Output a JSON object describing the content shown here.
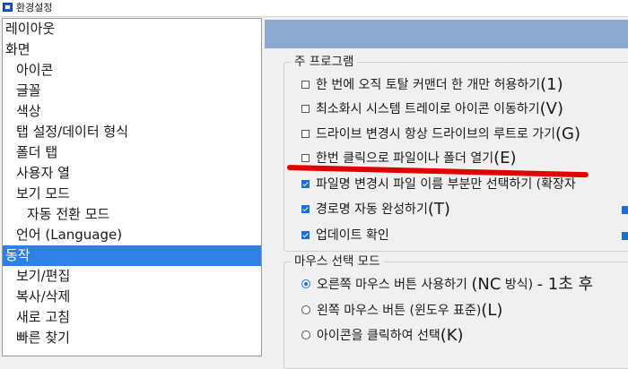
{
  "window": {
    "title": "환경설정"
  },
  "nav": {
    "items": [
      {
        "label": "레이아웃",
        "indent": 0,
        "selected": false
      },
      {
        "label": "화면",
        "indent": 0,
        "selected": false
      },
      {
        "label": "아이콘",
        "indent": 1,
        "selected": false
      },
      {
        "label": "글꼴",
        "indent": 1,
        "selected": false
      },
      {
        "label": "색상",
        "indent": 1,
        "selected": false
      },
      {
        "label": "탭 설정/데이터 형식",
        "indent": 1,
        "selected": false
      },
      {
        "label": "폴더 탭",
        "indent": 1,
        "selected": false
      },
      {
        "label": "사용자 열",
        "indent": 1,
        "selected": false
      },
      {
        "label": "보기 모드",
        "indent": 1,
        "selected": false
      },
      {
        "label": "자동 전환 모드",
        "indent": 2,
        "selected": false
      },
      {
        "label": "언어 (Language)",
        "indent": 1,
        "selected": false
      },
      {
        "label": "동작",
        "indent": 0,
        "selected": true
      },
      {
        "label": "보기/편집",
        "indent": 1,
        "selected": false
      },
      {
        "label": "복사/삭제",
        "indent": 1,
        "selected": false
      },
      {
        "label": "새로 고침",
        "indent": 1,
        "selected": false
      },
      {
        "label": "빠른 찾기",
        "indent": 1,
        "selected": false
      }
    ]
  },
  "main_program": {
    "title": "주 프로그램",
    "options": [
      {
        "text": "한 번에 오직 토탈 커맨더 한 개만 허용하기",
        "key": "(1)",
        "checked": false
      },
      {
        "text": "최소화시 시스템 트레이로 아이콘 이동하기",
        "key": "(V)",
        "checked": false
      },
      {
        "text": "드라이브 변경시 항상 드라이브의 루트로 가기",
        "key": "(G)",
        "checked": false
      },
      {
        "text": "한번 클릭으로 파일이나 폴더 열기",
        "key": "(E)",
        "checked": false
      },
      {
        "text": "파일명 변경시 파일 이름 부분만 선택하기 (확장자",
        "key": "",
        "checked": true
      },
      {
        "text": "경로명 자동 완성하기",
        "key": "(T)",
        "checked": true
      },
      {
        "text": "업데이트 확인",
        "key": "",
        "checked": true
      }
    ]
  },
  "mouse_mode": {
    "title": "마우스 선택 모드",
    "options": [
      {
        "pre": "오른쪽 마우스 버튼 사용하기 ",
        "em": "(NC",
        "mid": " 방식) ",
        "tail": "- 1초 후",
        "checked": true
      },
      {
        "pre": "왼쪽 마우스 버튼 (윈도우 표준)",
        "em": "(L)",
        "mid": "",
        "tail": "",
        "checked": false
      },
      {
        "pre": "아이콘을 클릭하여 선택",
        "em": "(K)",
        "mid": "",
        "tail": "",
        "checked": false
      }
    ]
  },
  "colors": {
    "selection": "#2e7fe6",
    "banner": "#8ca7d0",
    "annotation": "#e00000",
    "checkbox_on": "#1b6fd0"
  }
}
